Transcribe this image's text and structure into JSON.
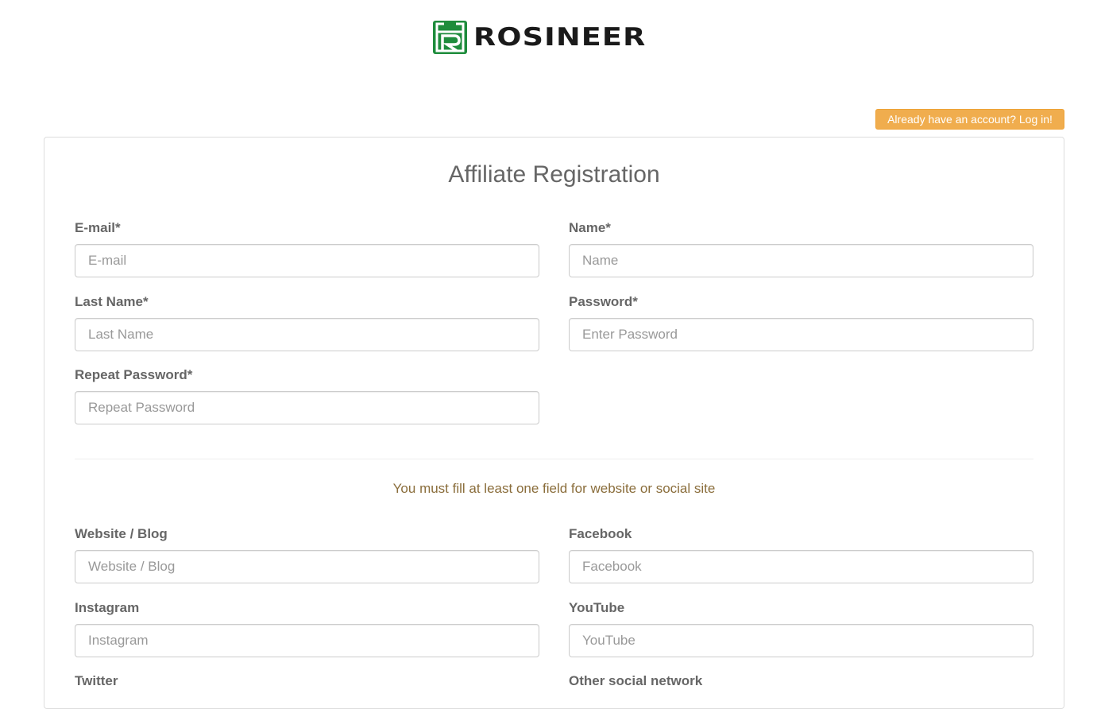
{
  "header": {
    "brand": "ROSINEER",
    "logo_icon": "rosineer-logo-icon",
    "brand_color": "#1e8c3c",
    "login_button": "Already have an account? Log in!"
  },
  "form": {
    "title": "Affiliate Registration",
    "fields": {
      "email": {
        "label": "E-mail*",
        "placeholder": "E-mail",
        "value": ""
      },
      "name": {
        "label": "Name*",
        "placeholder": "Name",
        "value": ""
      },
      "last_name": {
        "label": "Last Name*",
        "placeholder": "Last Name",
        "value": ""
      },
      "password": {
        "label": "Password*",
        "placeholder": "Enter Password",
        "value": ""
      },
      "repeat_password": {
        "label": "Repeat Password*",
        "placeholder": "Repeat Password",
        "value": ""
      }
    },
    "social_notice": "You must fill at least one field for website or social site",
    "social_fields": {
      "website": {
        "label": "Website / Blog",
        "placeholder": "Website / Blog",
        "value": ""
      },
      "facebook": {
        "label": "Facebook",
        "placeholder": "Facebook",
        "value": ""
      },
      "instagram": {
        "label": "Instagram",
        "placeholder": "Instagram",
        "value": ""
      },
      "youtube": {
        "label": "YouTube",
        "placeholder": "YouTube",
        "value": ""
      },
      "twitter": {
        "label": "Twitter"
      },
      "other": {
        "label": "Other social network"
      }
    }
  },
  "colors": {
    "accent_orange": "#f0ad4e",
    "notice_text": "#8a6d3b"
  }
}
